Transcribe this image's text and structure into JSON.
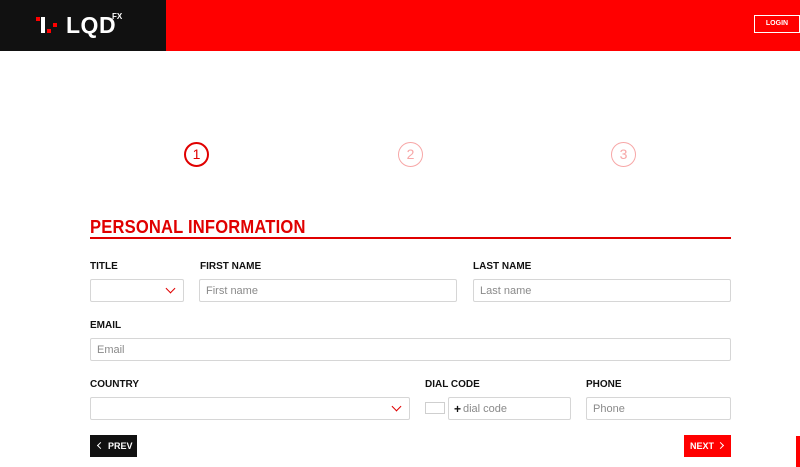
{
  "header": {
    "logo_text": "LQD",
    "logo_sup": "FX",
    "login_label": "LOGIN",
    "colors": {
      "brand_red": "#ff0000",
      "logo_bg": "#111111"
    }
  },
  "steps": [
    {
      "number": "1",
      "state": "active"
    },
    {
      "number": "2",
      "state": "inactive"
    },
    {
      "number": "3",
      "state": "inactive"
    }
  ],
  "section": {
    "title": "PERSONAL INFORMATION"
  },
  "form": {
    "title_label": "TITLE",
    "title_value": "",
    "first_name_label": "FIRST NAME",
    "first_name_placeholder": "First name",
    "last_name_label": "LAST NAME",
    "last_name_placeholder": "Last name",
    "email_label": "EMAIL",
    "email_placeholder": "Email",
    "country_label": "COUNTRY",
    "country_value": "",
    "dial_code_label": "DIAL CODE",
    "dial_plus": "+",
    "dial_placeholder": "dial code",
    "phone_label": "PHONE",
    "phone_placeholder": "Phone"
  },
  "nav": {
    "prev_label": "PREV",
    "next_label": "NEXT",
    "prev_icon": "chevron-left-icon",
    "next_icon": "chevron-right-icon"
  }
}
